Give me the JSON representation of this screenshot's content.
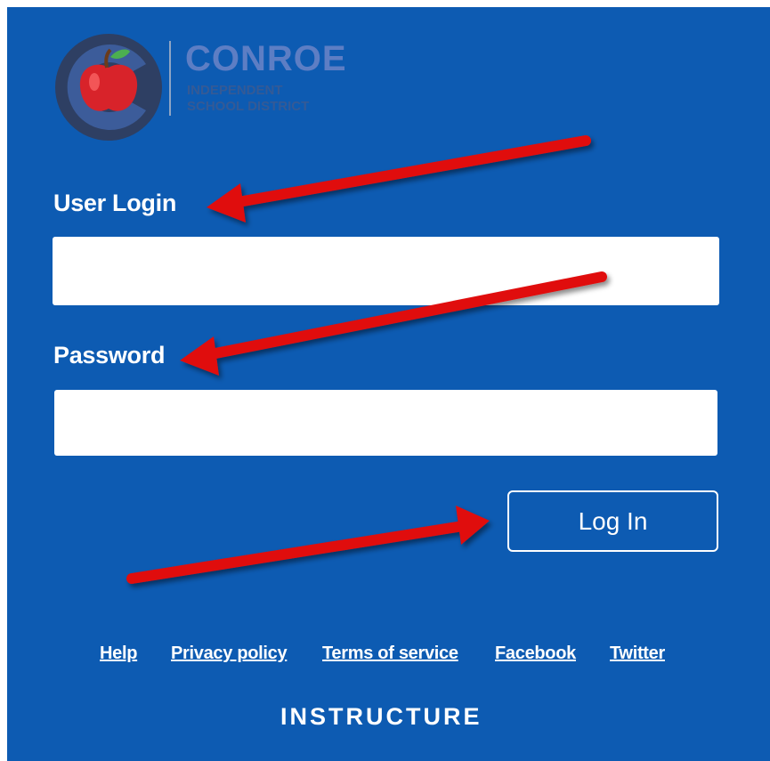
{
  "brand": {
    "name": "CONROE",
    "sub_line1": "INDEPENDENT",
    "sub_line2": "SCHOOL DISTRICT"
  },
  "form": {
    "user_login_label": "User Login",
    "user_login_value": "",
    "password_label": "Password",
    "password_value": "",
    "login_button": "Log In"
  },
  "footer": {
    "links": [
      "Help",
      "Privacy policy",
      "Terms of service",
      "Facebook",
      "Twitter"
    ],
    "wordmark": "INSTRUCTURE"
  },
  "colors": {
    "background": "#0d5bb2",
    "annotation_arrow": "#e01010"
  },
  "annotations": [
    {
      "icon": "red-arrow-icon",
      "points_to": "User Login"
    },
    {
      "icon": "red-arrow-icon",
      "points_to": "Password"
    },
    {
      "icon": "red-arrow-icon",
      "points_to": "Log In"
    }
  ]
}
